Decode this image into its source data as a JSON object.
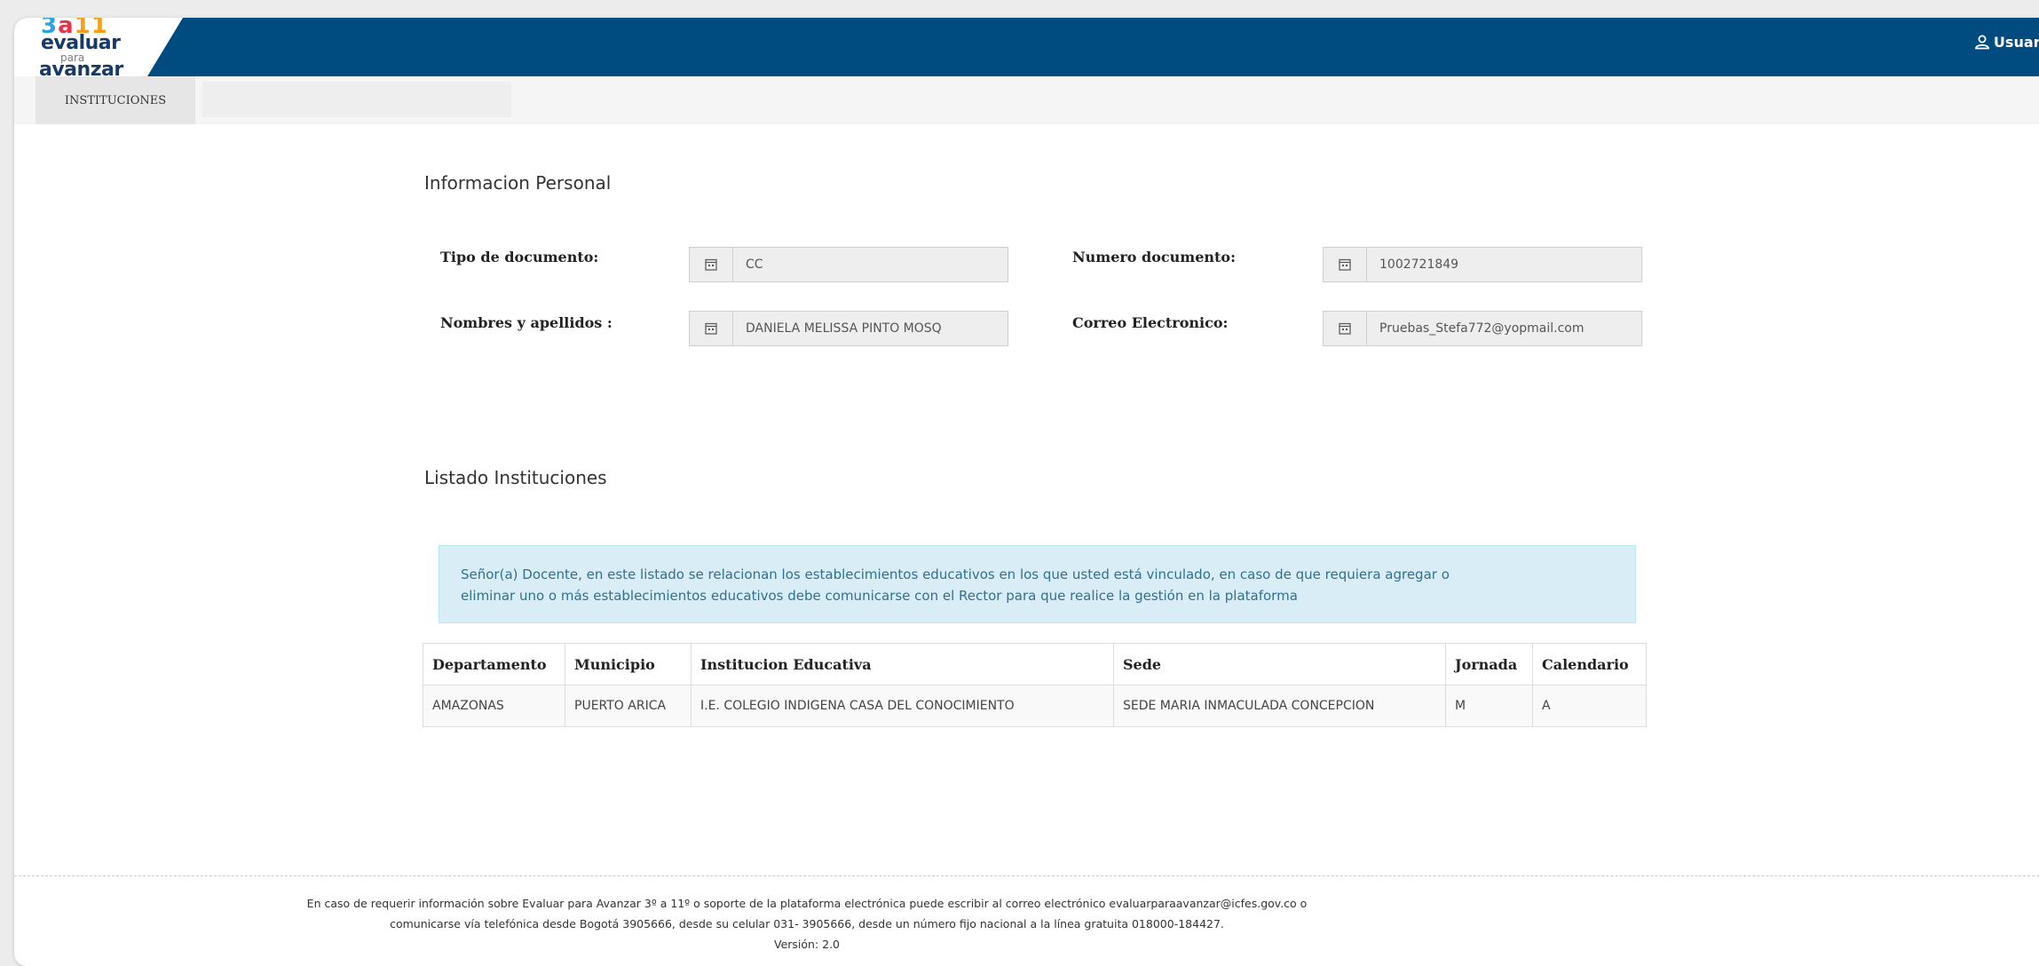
{
  "header": {
    "logo": {
      "line_top": "3 a 11",
      "line1": "evaluar",
      "line2": "para",
      "line3": "avanzar"
    },
    "user_label": "Usuario"
  },
  "nav": {
    "tab_instituciones": "INSTITUCIONES"
  },
  "personal": {
    "title": "Informacion Personal",
    "tipo_label": "Tipo de documento:",
    "tipo_value": "CC",
    "numero_label": "Numero documento:",
    "numero_value": "1002721849",
    "nombres_label": "Nombres y apellidos :",
    "nombres_value": "DANIELA MELISSA PINTO MOSQ",
    "correo_label": "Correo Electronico:",
    "correo_value": "Pruebas_Stefa772@yopmail.com"
  },
  "listado": {
    "title": "Listado Instituciones",
    "alert_line1": "Señor(a) Docente, en este listado se relacionan los establecimientos educativos en los que usted está vinculado, en caso de que requiera agregar o",
    "alert_line2": "eliminar uno o más establecimientos educativos debe comunicarse con el Rector para que realice la gestión en la plataforma",
    "columns": [
      "Departamento",
      "Municipio",
      "Institucion Educativa",
      "Sede",
      "Jornada",
      "Calendario"
    ],
    "rows": [
      [
        "AMAZONAS",
        "PUERTO ARICA",
        "I.E. COLEGIO INDIGENA CASA DEL CONOCIMIENTO",
        "SEDE MARIA INMACULADA CONCEPCION",
        "M",
        "A"
      ]
    ]
  },
  "footer": {
    "line1": "En caso de requerir información sobre Evaluar para Avanzar 3º a 11º o soporte de la plataforma electrónica puede escribir al correo electrónico evaluarparaavanzar@icfes.gov.co o",
    "line2": "comunicarse vía telefónica desde Bogotá 3905666, desde su celular 031- 3905666, desde un número fijo nacional a la línea gratuita 018000-184427.",
    "line3": "Versión: 2.0"
  },
  "colors": {
    "header_bg": "#004c81",
    "alert_bg": "#d9edf7",
    "alert_text": "#31708f"
  },
  "icons": {
    "user": "user-icon",
    "field": "calendar-icon"
  }
}
